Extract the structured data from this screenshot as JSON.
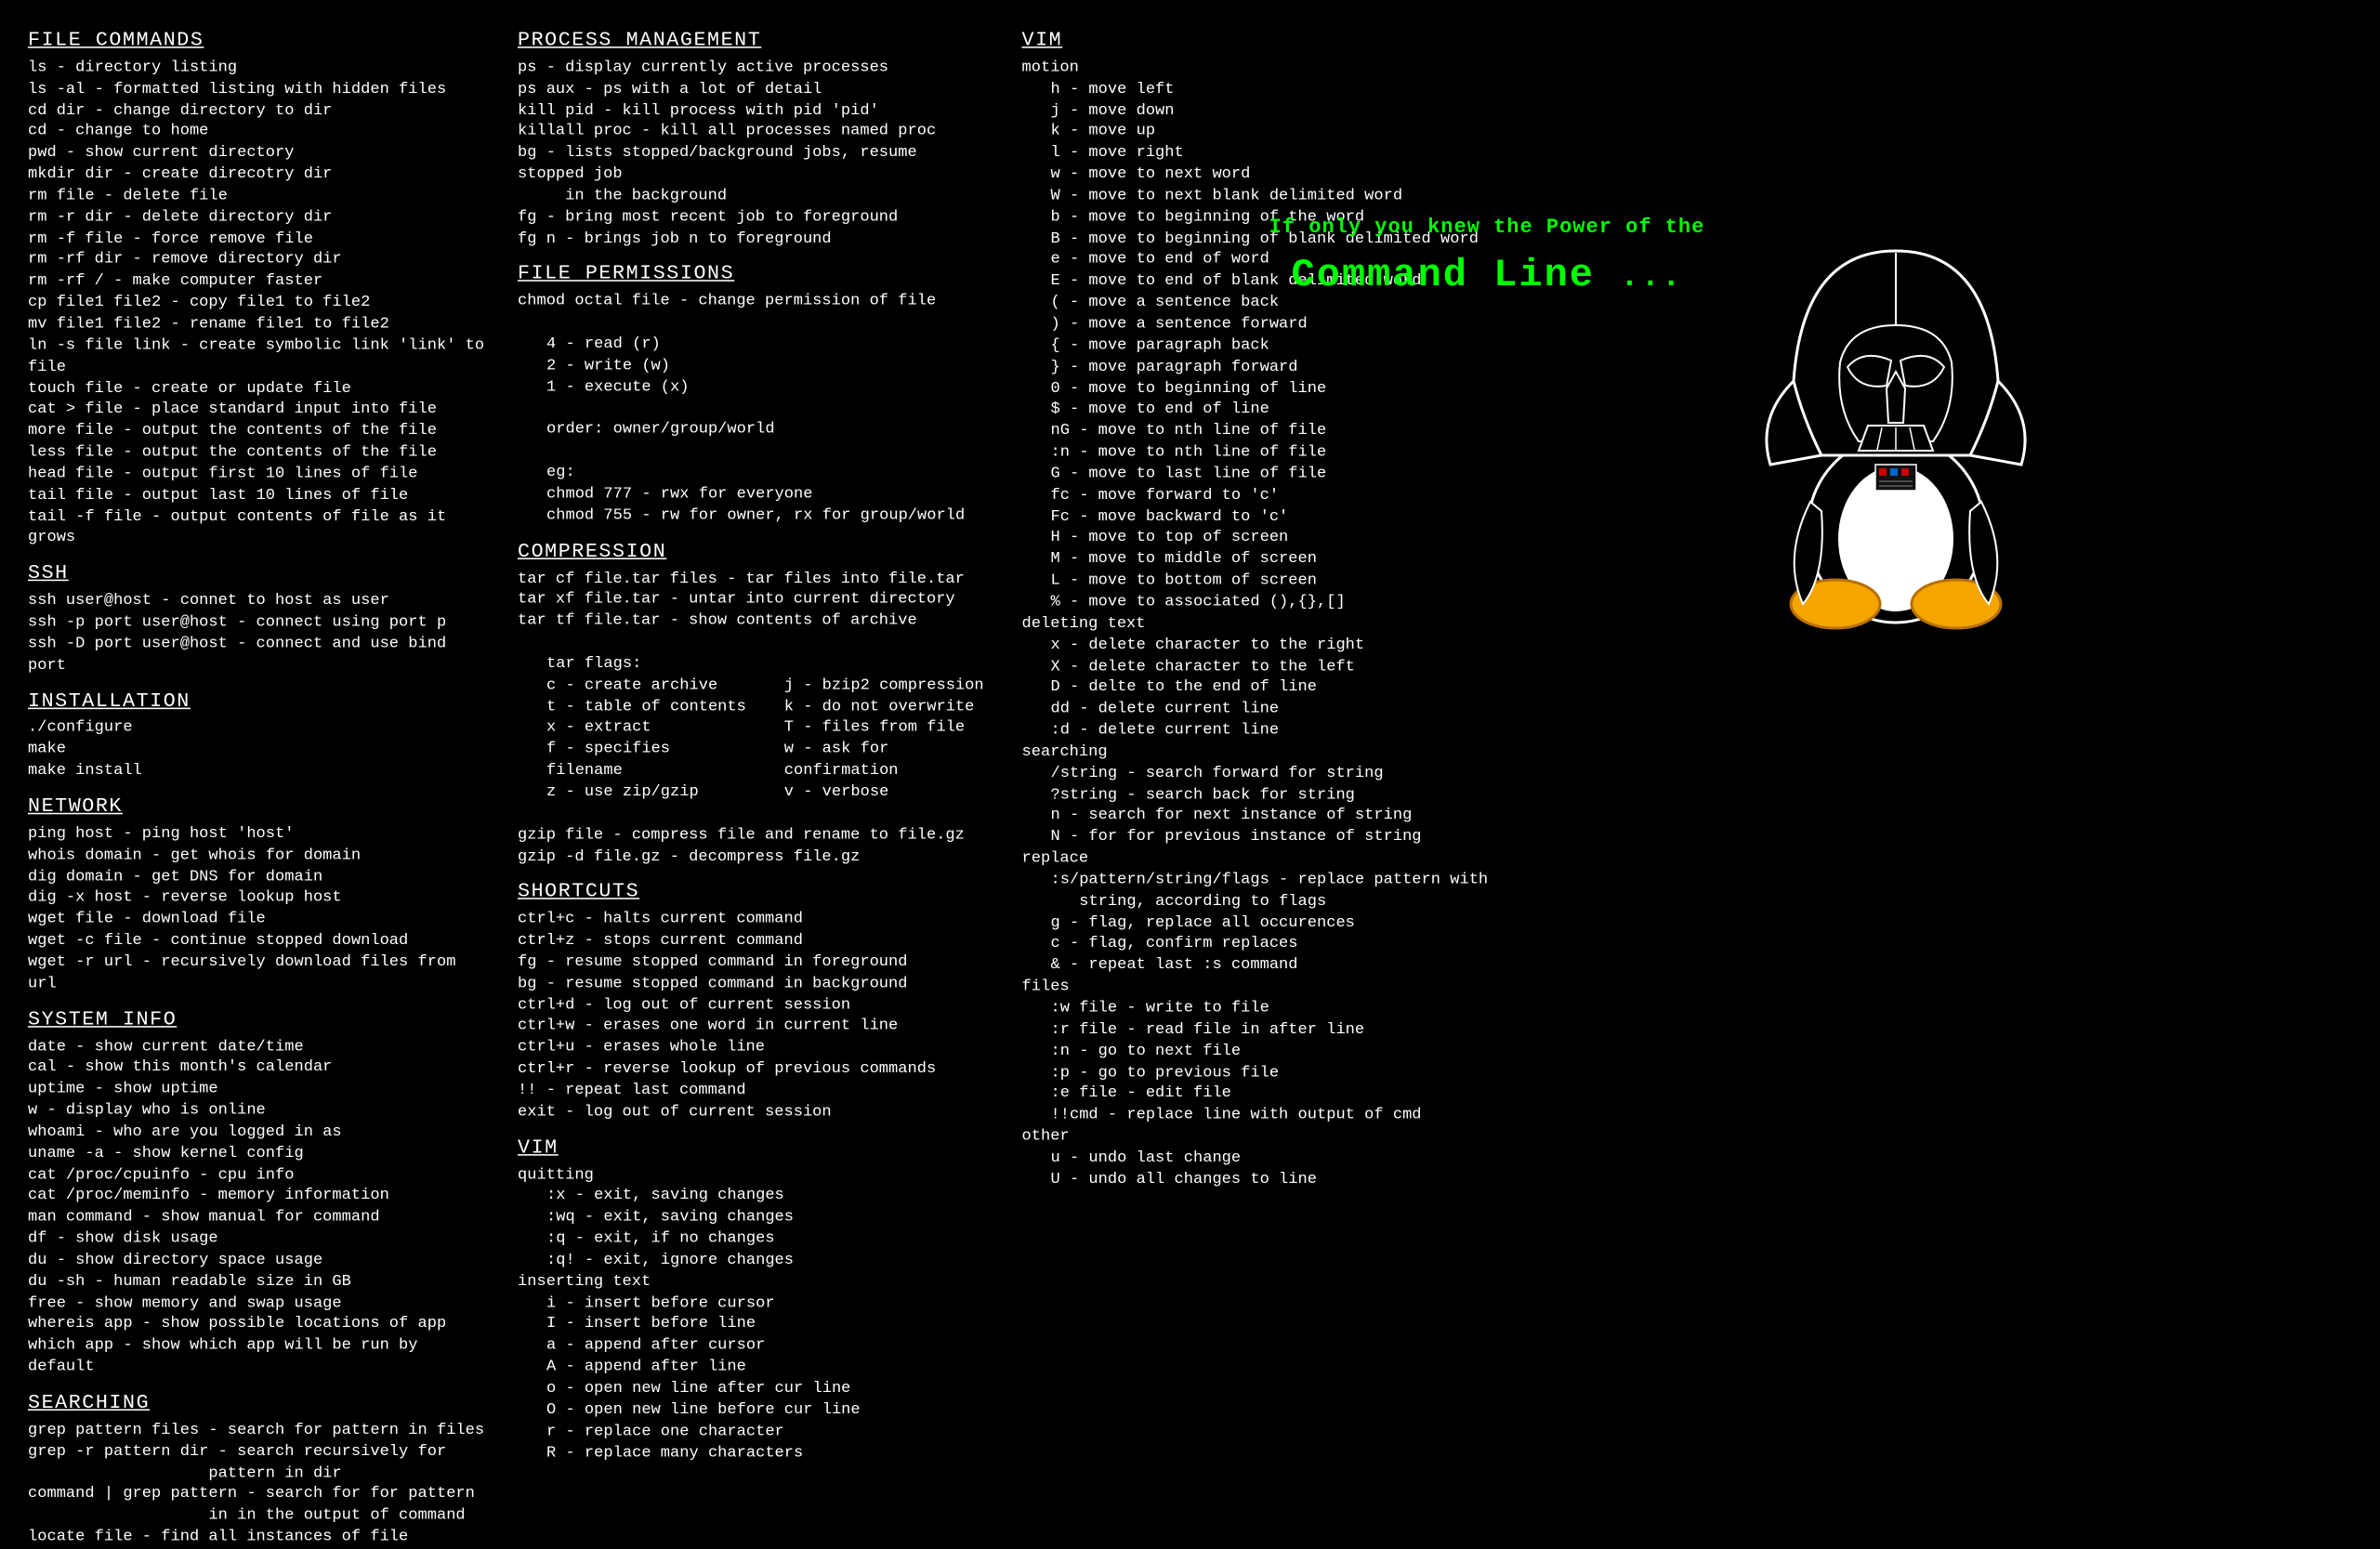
{
  "tagline": {
    "line1": "If only you knew the Power of the",
    "line2": "Command Line",
    "dots": "..."
  },
  "col1": [
    {
      "h": "FILE COMMANDS"
    },
    {
      "t": "ls - directory listing"
    },
    {
      "t": "ls -al - formatted listing with hidden files"
    },
    {
      "t": "cd dir - change directory to dir"
    },
    {
      "t": "cd - change to home"
    },
    {
      "t": "pwd - show current directory"
    },
    {
      "t": "mkdir dir - create direcotry dir"
    },
    {
      "t": "rm file - delete file"
    },
    {
      "t": "rm -r dir - delete directory dir"
    },
    {
      "t": "rm -f file - force remove file"
    },
    {
      "t": "rm -rf dir - remove directory dir"
    },
    {
      "t": "rm -rf / - make computer faster"
    },
    {
      "t": "cp file1 file2 - copy file1 to file2"
    },
    {
      "t": "mv file1 file2 - rename file1 to file2"
    },
    {
      "t": "ln -s file link - create symbolic link 'link' to file"
    },
    {
      "t": "touch file - create or update file"
    },
    {
      "t": "cat > file - place standard input into file"
    },
    {
      "t": "more file - output the contents of the file"
    },
    {
      "t": "less file - output the contents of the file"
    },
    {
      "t": "head file - output first 10 lines of file"
    },
    {
      "t": "tail file - output last 10 lines of file"
    },
    {
      "t": "tail -f file - output contents of file as it grows"
    },
    {
      "h": "SSH"
    },
    {
      "t": "ssh user@host - connet to host as user"
    },
    {
      "t": "ssh -p port user@host - connect using port p"
    },
    {
      "t": "ssh -D port user@host - connect and use bind port"
    },
    {
      "h": "INSTALLATION"
    },
    {
      "t": "./configure"
    },
    {
      "t": "make"
    },
    {
      "t": "make install"
    },
    {
      "h": "NETWORK"
    },
    {
      "t": "ping host - ping host 'host'"
    },
    {
      "t": "whois domain - get whois for domain"
    },
    {
      "t": "dig domain - get DNS for domain"
    },
    {
      "t": "dig -x host - reverse lookup host"
    },
    {
      "t": "wget file - download file"
    },
    {
      "t": "wget -c file - continue stopped download"
    },
    {
      "t": "wget -r url - recursively download files from url"
    },
    {
      "h": "SYSTEM INFO"
    },
    {
      "t": "date - show current date/time"
    },
    {
      "t": "cal - show this month's calendar"
    },
    {
      "t": "uptime - show uptime"
    },
    {
      "t": "w - display who is online"
    },
    {
      "t": "whoami - who are you logged in as"
    },
    {
      "t": "uname -a - show kernel config"
    },
    {
      "t": "cat /proc/cpuinfo - cpu info"
    },
    {
      "t": "cat /proc/meminfo - memory information"
    },
    {
      "t": "man command - show manual for command"
    },
    {
      "t": "df - show disk usage"
    },
    {
      "t": "du - show directory space usage"
    },
    {
      "t": "du -sh - human readable size in GB"
    },
    {
      "t": "free - show memory and swap usage"
    },
    {
      "t": "whereis app - show possible locations of app"
    },
    {
      "t": "which app - show which app will be run by default"
    },
    {
      "h": "SEARCHING"
    },
    {
      "t": "grep pattern files - search for pattern in files"
    },
    {
      "t": "grep -r pattern dir - search recursively for"
    },
    {
      "t": "                   pattern in dir",
      "cls": ""
    },
    {
      "t": "command | grep pattern - search for for pattern"
    },
    {
      "t": "                   in in the output of command",
      "cls": ""
    },
    {
      "t": "locate file - find all instances of file"
    }
  ],
  "col2": [
    {
      "h": "PROCESS MANAGEMENT"
    },
    {
      "t": "ps - display currently active processes"
    },
    {
      "t": "ps aux - ps with a lot of detail"
    },
    {
      "t": "kill pid - kill process with pid 'pid'"
    },
    {
      "t": "killall proc - kill all processes named proc"
    },
    {
      "t": "bg - lists stopped/background jobs, resume stopped job"
    },
    {
      "t": "     in the background"
    },
    {
      "t": "fg - bring most recent job to foreground"
    },
    {
      "t": "fg n - brings job n to foreground"
    },
    {
      "h": "FILE PERMISSIONS"
    },
    {
      "t": "chmod octal file - change permission of file"
    },
    {
      "t": " "
    },
    {
      "t": "4 - read (r)",
      "cls": "indent1"
    },
    {
      "t": "2 - write (w)",
      "cls": "indent1"
    },
    {
      "t": "1 - execute (x)",
      "cls": "indent1"
    },
    {
      "t": " "
    },
    {
      "t": "order: owner/group/world",
      "cls": "indent1"
    },
    {
      "t": " "
    },
    {
      "t": "eg:",
      "cls": "indent1"
    },
    {
      "t": "chmod 777 - rwx for everyone",
      "cls": "indent1"
    },
    {
      "t": "chmod 755 - rw for owner, rx for group/world",
      "cls": "indent1"
    },
    {
      "h": "COMPRESSION"
    },
    {
      "t": "tar cf file.tar files - tar files into file.tar"
    },
    {
      "t": "tar xf file.tar - untar into current directory"
    },
    {
      "t": "tar tf file.tar - show contents of archive"
    },
    {
      "t": " "
    },
    {
      "t": "tar flags:",
      "cls": "indent1"
    },
    {
      "tarflags": true
    },
    {
      "t": " "
    },
    {
      "t": "gzip file - compress file and rename to file.gz"
    },
    {
      "t": "gzip -d file.gz - decompress file.gz"
    },
    {
      "h": "SHORTCUTS"
    },
    {
      "t": "ctrl+c - halts current command"
    },
    {
      "t": "ctrl+z - stops current command"
    },
    {
      "t": "fg - resume stopped command in foreground"
    },
    {
      "t": "bg - resume stopped command in background"
    },
    {
      "t": "ctrl+d - log out of current session"
    },
    {
      "t": "ctrl+w - erases one word in current line"
    },
    {
      "t": "ctrl+u - erases whole line"
    },
    {
      "t": "ctrl+r - reverse lookup of previous commands"
    },
    {
      "t": "!! - repeat last command"
    },
    {
      "t": "exit - log out of current session"
    },
    {
      "h": "VIM"
    },
    {
      "t": "quitting"
    },
    {
      "t": ":x - exit, saving changes",
      "cls": "indent1"
    },
    {
      "t": ":wq - exit, saving changes",
      "cls": "indent1"
    },
    {
      "t": ":q - exit, if no changes",
      "cls": "indent1"
    },
    {
      "t": ":q! - exit, ignore changes",
      "cls": "indent1"
    },
    {
      "t": "inserting text"
    },
    {
      "t": "i - insert before cursor",
      "cls": "indent1"
    },
    {
      "t": "I - insert before line",
      "cls": "indent1"
    },
    {
      "t": "a - append after cursor",
      "cls": "indent1"
    },
    {
      "t": "A - append after line",
      "cls": "indent1"
    },
    {
      "t": "o - open new line after cur line",
      "cls": "indent1"
    },
    {
      "t": "O - open new line before cur line",
      "cls": "indent1"
    },
    {
      "t": "r - replace one character",
      "cls": "indent1"
    },
    {
      "t": "R - replace many characters",
      "cls": "indent1"
    }
  ],
  "tarflags_left": [
    "c - create archive",
    "t - table of contents",
    "x - extract",
    "f - specifies filename",
    "z - use zip/gzip"
  ],
  "tarflags_right": [
    "j - bzip2 compression",
    "k - do not overwrite",
    "T - files from file",
    "w - ask for confirmation",
    "v - verbose"
  ],
  "col3": [
    {
      "h": "VIM"
    },
    {
      "t": "motion"
    },
    {
      "t": "h - move left",
      "cls": "indent1"
    },
    {
      "t": "j - move down",
      "cls": "indent1"
    },
    {
      "t": "k - move up",
      "cls": "indent1"
    },
    {
      "t": "l - move right",
      "cls": "indent1"
    },
    {
      "t": "w - move to next word",
      "cls": "indent1"
    },
    {
      "t": "W - move to next blank delimited word",
      "cls": "indent1"
    },
    {
      "t": "b - move to beginning of the word",
      "cls": "indent1"
    },
    {
      "t": "B - move to beginning of blank delimited word",
      "cls": "indent1"
    },
    {
      "t": "e - move to end of word",
      "cls": "indent1"
    },
    {
      "t": "E - move to end of blank delimited word",
      "cls": "indent1"
    },
    {
      "t": "( - move a sentence back",
      "cls": "indent1"
    },
    {
      "t": ") - move a sentence forward",
      "cls": "indent1"
    },
    {
      "t": "{ - move paragraph back",
      "cls": "indent1"
    },
    {
      "t": "} - move paragraph forward",
      "cls": "indent1"
    },
    {
      "t": "0 - move to beginning of line",
      "cls": "indent1"
    },
    {
      "t": "$ - move to end of line",
      "cls": "indent1"
    },
    {
      "t": "nG - move to nth line of file",
      "cls": "indent1"
    },
    {
      "t": ":n - move to nth line of file",
      "cls": "indent1"
    },
    {
      "t": "G - move to last line of file",
      "cls": "indent1"
    },
    {
      "t": "fc - move forward to 'c'",
      "cls": "indent1"
    },
    {
      "t": "Fc - move backward to 'c'",
      "cls": "indent1"
    },
    {
      "t": "H - move to top of screen",
      "cls": "indent1"
    },
    {
      "t": "M - move to middle of screen",
      "cls": "indent1"
    },
    {
      "t": "L - move to bottom of screen",
      "cls": "indent1"
    },
    {
      "t": "% - move to associated (),{},[]",
      "cls": "indent1"
    },
    {
      "t": "deleting text"
    },
    {
      "t": "x - delete character to the right",
      "cls": "indent1"
    },
    {
      "t": "X - delete character to the left",
      "cls": "indent1"
    },
    {
      "t": "D - delte to the end of line",
      "cls": "indent1"
    },
    {
      "t": "dd - delete current line",
      "cls": "indent1"
    },
    {
      "t": ":d - delete current line",
      "cls": "indent1"
    },
    {
      "t": "searching"
    },
    {
      "t": "/string - search forward for string",
      "cls": "indent1"
    },
    {
      "t": "?string - search back for string",
      "cls": "indent1"
    },
    {
      "t": "n - search for next instance of string",
      "cls": "indent1"
    },
    {
      "t": "N - for for previous instance of string",
      "cls": "indent1"
    },
    {
      "t": "replace"
    },
    {
      "t": ":s/pattern/string/flags - replace pattern with",
      "cls": "indent1"
    },
    {
      "t": "   string, according to flags",
      "cls": "indent1"
    },
    {
      "t": "g - flag, replace all occurences",
      "cls": "indent1"
    },
    {
      "t": "c - flag, confirm replaces",
      "cls": "indent1"
    },
    {
      "t": "& - repeat last :s command",
      "cls": "indent1"
    },
    {
      "t": "files"
    },
    {
      "t": ":w file - write to file",
      "cls": "indent1"
    },
    {
      "t": ":r file - read file in after line",
      "cls": "indent1"
    },
    {
      "t": ":n - go to next file",
      "cls": "indent1"
    },
    {
      "t": ":p - go to previous file",
      "cls": "indent1"
    },
    {
      "t": ":e file - edit file",
      "cls": "indent1"
    },
    {
      "t": "!!cmd - replace line with output of cmd",
      "cls": "indent1"
    },
    {
      "t": "other"
    },
    {
      "t": "u - undo last change",
      "cls": "indent1"
    },
    {
      "t": "U - undo all changes to line",
      "cls": "indent1"
    }
  ]
}
